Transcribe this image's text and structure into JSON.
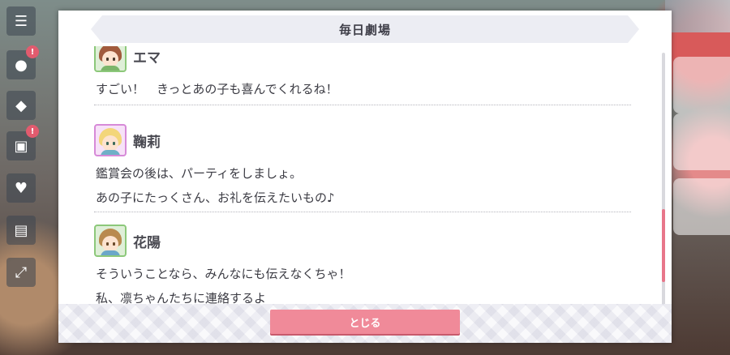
{
  "window": {
    "title": "毎日劇場",
    "close_label": "とじる"
  },
  "entries": [
    {
      "speaker": "エマ",
      "avatar_icon": "emma-avatar-icon",
      "lines": [
        "すごい！　きっとあの子も喜んでくれるね！"
      ]
    },
    {
      "speaker": "鞠莉",
      "avatar_icon": "mari-avatar-icon",
      "lines": [
        "鑑賞会の後は、パーティをしましょ。",
        "あの子にたっくさん、お礼を伝えたいもの♪"
      ]
    },
    {
      "speaker": "花陽",
      "avatar_icon": "hanayo-avatar-icon",
      "lines": [
        "そういうことなら、みんなにも伝えなくちゃ！",
        "私、凛ちゃんたちに連絡するよ"
      ]
    }
  ],
  "scroll": {
    "position_fraction": 0.86
  },
  "colors": {
    "accent": "#f08a99",
    "scroll_thumb": "#e8768a",
    "header_bg": "#ecedf3"
  }
}
